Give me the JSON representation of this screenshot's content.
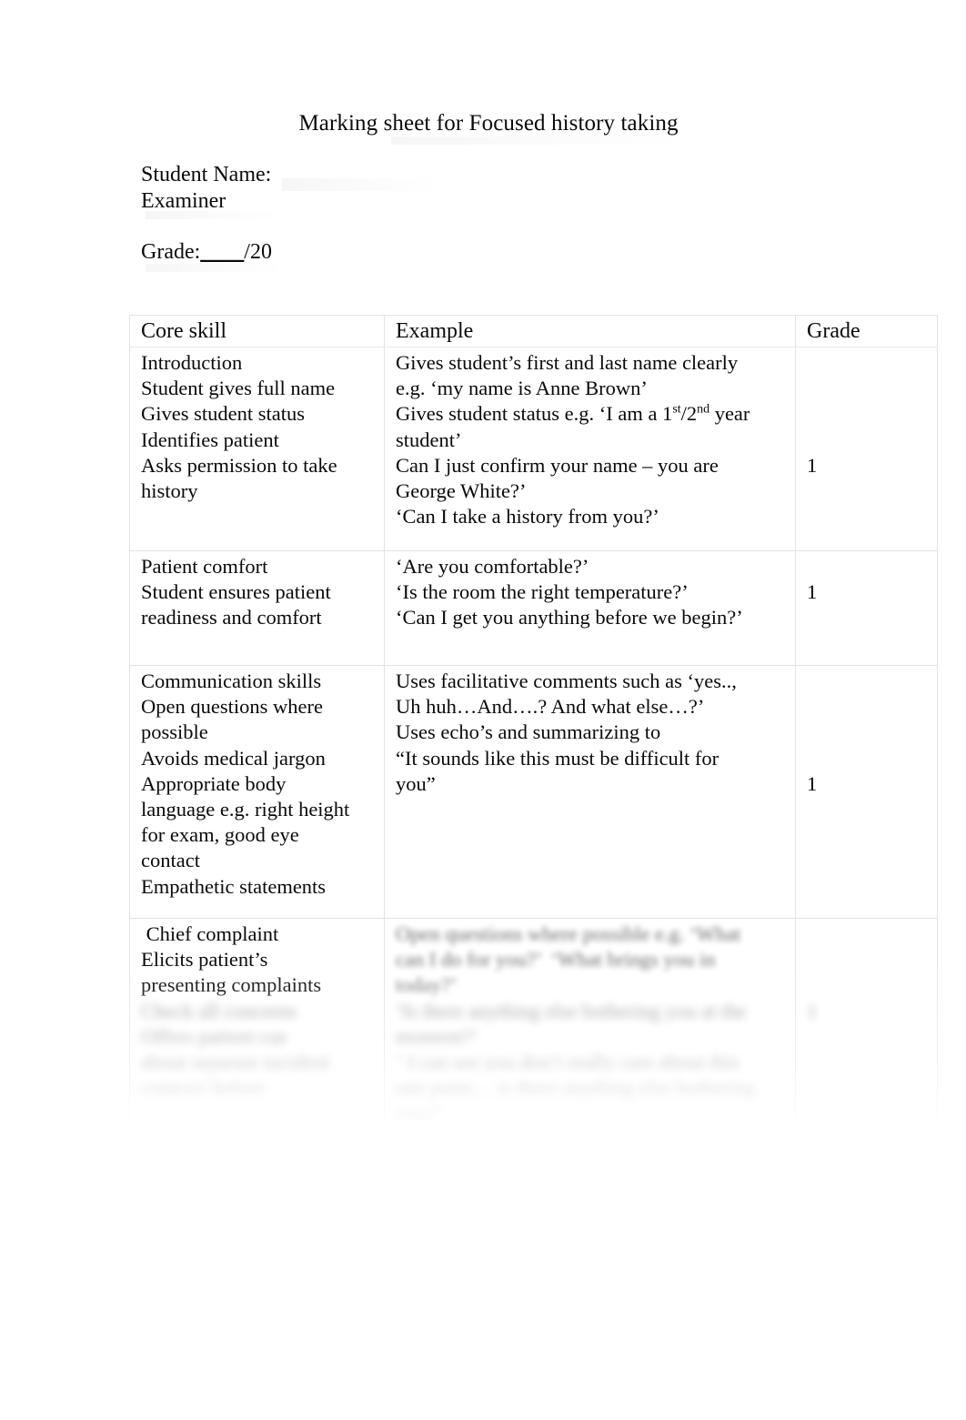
{
  "document": {
    "title": "Marking sheet for Focused history taking",
    "student_name_label": "Student Name:",
    "examiner_label": "Examiner",
    "grade_label": "Grade:",
    "grade_blank": "____",
    "grade_total": "/20"
  },
  "table": {
    "headers": {
      "core_skill": "Core skill",
      "example": "Example",
      "grade": "Grade"
    },
    "rows": [
      {
        "skill_lines": [
          "Introduction",
          "Student gives full name",
          "Gives student status",
          "Identifies patient",
          "Asks permission to take",
          "history"
        ],
        "example_lines": [
          "Gives student’s first and last name clearly",
          "e.g. ‘my name is Anne Brown’",
          "Gives student status e.g. ‘I am a 1st/2nd year",
          "student’",
          "Can I just confirm your name – you are",
          "George White?’",
          "‘Can I take a history from you?’"
        ],
        "grade": "1",
        "blurred": false
      },
      {
        "skill_lines": [
          "Patient comfort",
          "Student ensures patient",
          "readiness and comfort"
        ],
        "example_lines": [
          "‘Are you comfortable?’",
          "‘Is the room the right temperature?’",
          "‘Can I get you anything before we begin?’"
        ],
        "grade": "1",
        "blurred": false
      },
      {
        "skill_lines": [
          "Communication skills",
          "Open questions where",
          "possible",
          "Avoids medical jargon",
          "Appropriate body",
          "language e.g. right height",
          "for exam, good eye",
          "contact",
          "Empathetic statements"
        ],
        "example_lines": [
          "Uses facilitative comments such as ‘yes..,",
          "Uh huh…And….? And what else…?’",
          "Uses echo’s and summarizing to",
          "“It sounds like this must be difficult for",
          "you”"
        ],
        "grade": "1",
        "blurred": false
      },
      {
        "skill_lines": [
          " Chief complaint",
          "Elicits patient’s",
          "presenting complaints"
        ],
        "skill_lines_obscured": [
          "Check all concerns",
          "Offers patient cue",
          "about separate incident",
          "context/ before"
        ],
        "example_lines_obscured": [
          "Open questions where possible e.g. ‘What",
          "can I do for you?’  ‘What brings you in",
          "today?’",
          "‘Is there anything else bothering you at the",
          "moment?’",
          "‘ I can see you don’t really care about this",
          "one point… is there anything else bothering",
          "you?’"
        ],
        "grade": "1",
        "blurred": true
      }
    ]
  }
}
